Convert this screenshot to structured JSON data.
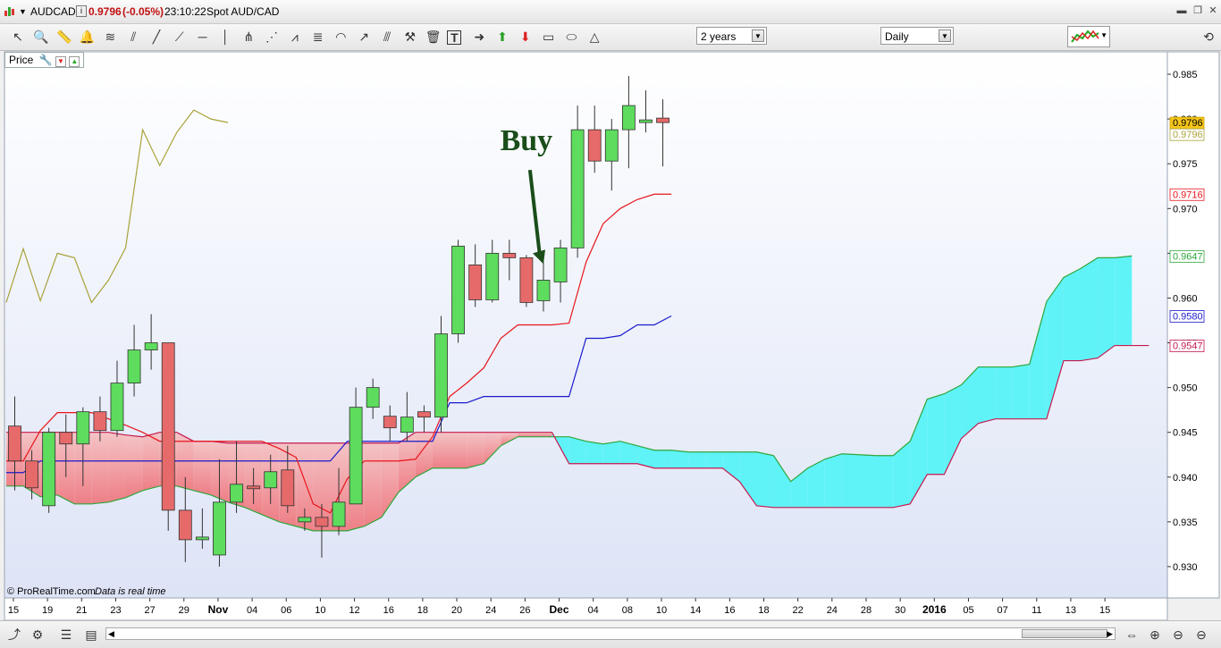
{
  "window": {
    "symbol": "AUDCAD",
    "info_icon": "info-icon",
    "last_price": "0.9796",
    "change": "(-0.05%)",
    "time": "23:10:22",
    "description": "Spot AUD/CAD"
  },
  "toolbar": {
    "period_select": "2 years",
    "interval_select": "Daily",
    "tools": [
      "cursor-icon",
      "zoom-icon",
      "ruler-icon",
      "alarm-icon",
      "fibonacci-icon",
      "channel-icon",
      "line-icon",
      "trendline-icon",
      "horizontal-line-icon",
      "vertical-line-icon",
      "pitchfork-icon",
      "fan-icon",
      "zigzag-icon",
      "regression-icon",
      "arc-icon",
      "extend-line-icon",
      "parallel-line-icon",
      "tools-icon",
      "delete-icon",
      "text-icon",
      "arrow-right-icon",
      "arrow-up-icon",
      "arrow-down-icon",
      "rectangle-icon",
      "ellipse-icon",
      "triangle-icon"
    ]
  },
  "price_panel": {
    "label": "Price"
  },
  "footer": {
    "copyright": "© ProRealTime.com",
    "note": "Data is real time"
  },
  "colors": {
    "bull": "#5ddc5d",
    "bear": "#e66a6a",
    "kijun": "#1a1acc",
    "tenkan": "#e8151b",
    "chikou": "#a8a23a",
    "cloud_bull": "#5ff3f7",
    "cloud_bear": "#f09aa0",
    "span_a": "#2fa63a",
    "span_b": "#c5194f",
    "annotation": "#1a4d1a"
  },
  "chart_data": {
    "type": "candlestick",
    "title": "",
    "ylim": [
      0.9265,
      0.9875
    ],
    "yticks": [
      0.93,
      0.935,
      0.94,
      0.945,
      0.95,
      0.955,
      0.96,
      0.965,
      0.97,
      0.975,
      0.98,
      0.985
    ],
    "xticks": [
      "15",
      "19",
      "21",
      "23",
      "27",
      "29",
      "Nov",
      "04",
      "06",
      "10",
      "12",
      "16",
      "18",
      "20",
      "24",
      "26",
      "Dec",
      "04",
      "08",
      "10",
      "14",
      "16",
      "18",
      "22",
      "24",
      "28",
      "30",
      "2016",
      "05",
      "07",
      "11",
      "13",
      "15"
    ],
    "series": [
      {
        "name": "Candles",
        "data": [
          [
            0.9457,
            0.949,
            0.9385,
            0.9418
          ],
          [
            0.9418,
            0.943,
            0.9375,
            0.9388
          ],
          [
            0.9368,
            0.9455,
            0.936,
            0.945
          ],
          [
            0.945,
            0.947,
            0.94,
            0.9437
          ],
          [
            0.9437,
            0.9478,
            0.939,
            0.9473
          ],
          [
            0.9473,
            0.949,
            0.944,
            0.9452
          ],
          [
            0.9452,
            0.953,
            0.9445,
            0.9505
          ],
          [
            0.9505,
            0.957,
            0.949,
            0.9542
          ],
          [
            0.9542,
            0.9582,
            0.952,
            0.955
          ],
          [
            0.955,
            0.955,
            0.934,
            0.9363
          ],
          [
            0.9363,
            0.94,
            0.9305,
            0.933
          ],
          [
            0.933,
            0.9365,
            0.932,
            0.9333
          ],
          [
            0.9313,
            0.942,
            0.93,
            0.9372
          ],
          [
            0.9372,
            0.944,
            0.936,
            0.9392
          ],
          [
            0.939,
            0.941,
            0.937,
            0.9387
          ],
          [
            0.9388,
            0.9425,
            0.937,
            0.9406
          ],
          [
            0.9408,
            0.9435,
            0.936,
            0.9368
          ],
          [
            0.935,
            0.9365,
            0.934,
            0.9355
          ],
          [
            0.9355,
            0.937,
            0.931,
            0.9345
          ],
          [
            0.9345,
            0.941,
            0.9335,
            0.9372
          ],
          [
            0.937,
            0.95,
            0.937,
            0.9478
          ],
          [
            0.9478,
            0.951,
            0.9465,
            0.95
          ],
          [
            0.9468,
            0.948,
            0.944,
            0.9455
          ],
          [
            0.945,
            0.9495,
            0.944,
            0.9467
          ],
          [
            0.9473,
            0.948,
            0.945,
            0.9467
          ],
          [
            0.9467,
            0.958,
            0.945,
            0.956
          ],
          [
            0.956,
            0.9665,
            0.955,
            0.9658
          ],
          [
            0.9637,
            0.966,
            0.959,
            0.9598
          ],
          [
            0.9598,
            0.9665,
            0.9595,
            0.965
          ],
          [
            0.965,
            0.9665,
            0.962,
            0.9645
          ],
          [
            0.9645,
            0.9648,
            0.959,
            0.9595
          ],
          [
            0.9597,
            0.964,
            0.9585,
            0.962
          ],
          [
            0.9618,
            0.9665,
            0.9595,
            0.9656
          ],
          [
            0.9656,
            0.9815,
            0.9645,
            0.9788
          ],
          [
            0.9788,
            0.9815,
            0.974,
            0.9753
          ],
          [
            0.9753,
            0.98,
            0.972,
            0.9788
          ],
          [
            0.9788,
            0.9848,
            0.9745,
            0.9815
          ],
          [
            0.9796,
            0.9832,
            0.9785,
            0.9799
          ],
          [
            0.9801,
            0.9822,
            0.9747,
            0.9796
          ]
        ]
      },
      {
        "name": "Tenkan",
        "values": [
          0.9418,
          0.9418,
          0.9452,
          0.9472,
          0.9472,
          0.9472,
          0.9465,
          0.9458,
          0.945,
          0.944,
          0.944,
          0.944,
          0.944,
          0.944,
          0.944,
          0.944,
          0.9432,
          0.9422,
          0.937,
          0.936,
          0.9398,
          0.9418,
          0.9418,
          0.9418,
          0.942,
          0.9445,
          0.949,
          0.9505,
          0.9522,
          0.9555,
          0.957,
          0.957,
          0.957,
          0.9572,
          0.964,
          0.9683,
          0.97,
          0.971,
          0.9716,
          0.9716
        ]
      },
      {
        "name": "Kijun",
        "values": [
          0.9405,
          0.9405,
          0.9418,
          0.9418,
          0.9418,
          0.9418,
          0.9418,
          0.9418,
          0.9418,
          0.9418,
          0.9418,
          0.9418,
          0.9418,
          0.9418,
          0.9418,
          0.9418,
          0.9418,
          0.9418,
          0.9418,
          0.9418,
          0.944,
          0.944,
          0.944,
          0.944,
          0.944,
          0.944,
          0.9483,
          0.9483,
          0.949,
          0.949,
          0.949,
          0.949,
          0.949,
          0.949,
          0.9555,
          0.9555,
          0.9558,
          0.957,
          0.957,
          0.958
        ]
      },
      {
        "name": "Chikou",
        "values": [
          0.9595,
          0.9655,
          0.9597,
          0.965,
          0.9645,
          0.9595,
          0.962,
          0.9656,
          0.9788,
          0.9748,
          0.9785,
          0.981,
          0.98,
          0.9796
        ]
      },
      {
        "name": "Senkou A",
        "values": [
          0.939,
          0.939,
          0.9378,
          0.938,
          0.937,
          0.937,
          0.9372,
          0.9377,
          0.9385,
          0.939,
          0.939,
          0.9385,
          0.938,
          0.9372,
          0.9366,
          0.9358,
          0.935,
          0.9345,
          0.934,
          0.934,
          0.934,
          0.9345,
          0.9355,
          0.9383,
          0.94,
          0.941,
          0.941,
          0.941,
          0.9415,
          0.9435,
          0.9445,
          0.9445,
          0.9445,
          0.9445,
          0.944,
          0.9437,
          0.944,
          0.9435,
          0.943,
          0.943,
          0.9428,
          0.9428,
          0.9428,
          0.9428,
          0.9428,
          0.9424,
          0.9395,
          0.941,
          0.942,
          0.9426,
          0.9425,
          0.9424,
          0.9424,
          0.944,
          0.9487,
          0.9493,
          0.9503,
          0.9523,
          0.9523,
          0.9523,
          0.9526,
          0.9596,
          0.9623,
          0.9633,
          0.9645,
          0.9645,
          0.9647
        ]
      },
      {
        "name": "Senkou B",
        "values": [
          0.945,
          0.945,
          0.945,
          0.945,
          0.945,
          0.945,
          0.945,
          0.9447,
          0.9445,
          0.945,
          0.945,
          0.944,
          0.944,
          0.9438,
          0.9438,
          0.9438,
          0.9438,
          0.9438,
          0.9438,
          0.9438,
          0.9438,
          0.9438,
          0.9438,
          0.9438,
          0.945,
          0.945,
          0.945,
          0.945,
          0.945,
          0.945,
          0.945,
          0.945,
          0.945,
          0.9415,
          0.9415,
          0.9415,
          0.9415,
          0.9415,
          0.941,
          0.941,
          0.941,
          0.941,
          0.941,
          0.9395,
          0.9368,
          0.9366,
          0.9366,
          0.9366,
          0.9366,
          0.9366,
          0.9366,
          0.9366,
          0.9366,
          0.937,
          0.9403,
          0.9403,
          0.9443,
          0.946,
          0.9465,
          0.9465,
          0.9465,
          0.9465,
          0.953,
          0.953,
          0.9533,
          0.9547,
          0.9547,
          0.9547
        ]
      }
    ],
    "price_tags": [
      {
        "label": "0.9796",
        "value": 0.9796,
        "bg": "#f6c51a",
        "fg": "#000000"
      },
      {
        "label": "0.9796",
        "value": 0.9783,
        "bg": "#ffffff",
        "fg": "#a8a23a"
      },
      {
        "label": "0.9716",
        "value": 0.9716,
        "bg": "#ffffff",
        "fg": "#e8151b"
      },
      {
        "label": "0.9647",
        "value": 0.9647,
        "bg": "#ffffff",
        "fg": "#2fa63a"
      },
      {
        "label": "0.9580",
        "value": 0.958,
        "bg": "#ffffff",
        "fg": "#1a1acc"
      },
      {
        "label": "0.9547",
        "value": 0.9547,
        "bg": "#ffffff",
        "fg": "#c5194f"
      }
    ],
    "annotation": {
      "text": "Buy",
      "x_index": 30.0,
      "value": 0.9765,
      "arrow_to_index": 31.0,
      "arrow_to_value": 0.9638
    }
  }
}
